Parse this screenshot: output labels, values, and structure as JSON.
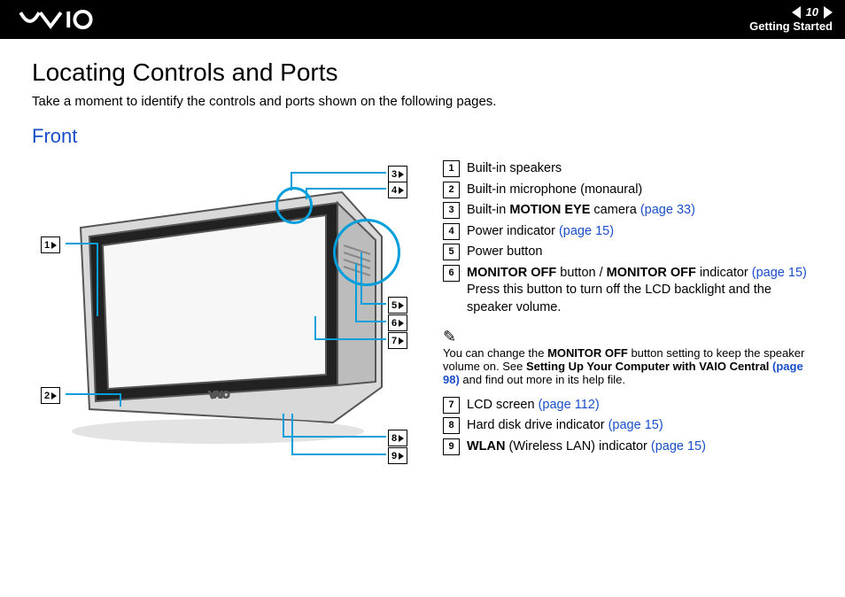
{
  "header": {
    "page_number": "10",
    "section": "Getting Started"
  },
  "title": "Locating Controls and Ports",
  "intro": "Take a moment to identify the controls and ports shown on the following pages.",
  "subhead": "Front",
  "items": [
    {
      "n": "1",
      "pre": "",
      "bold": "",
      "post": "Built-in speakers",
      "link": ""
    },
    {
      "n": "2",
      "pre": "",
      "bold": "",
      "post": "Built-in microphone (monaural)",
      "link": ""
    },
    {
      "n": "3",
      "pre": "Built-in ",
      "bold": "MOTION EYE",
      "post": " camera ",
      "link": "(page 33)"
    },
    {
      "n": "4",
      "pre": "",
      "bold": "",
      "post": "Power indicator ",
      "link": "(page 15)"
    },
    {
      "n": "5",
      "pre": "",
      "bold": "",
      "post": "Power button",
      "link": ""
    }
  ],
  "item6": {
    "n": "6",
    "part1": "MONITOR OFF",
    "mid": " button / ",
    "part2": "MONITOR OFF",
    "tail": " indicator ",
    "link": "(page 15)",
    "desc": "Press this button to turn off the LCD backlight and the speaker volume."
  },
  "note": {
    "pre": "You can change the ",
    "bold1": "MONITOR OFF",
    "mid": " button setting to keep the speaker volume on. See ",
    "bold2": "Setting Up Your Computer with VAIO Central ",
    "link": "(page 98)",
    "post": " and find out more in its help file."
  },
  "items2": [
    {
      "n": "7",
      "pre": "",
      "bold": "",
      "post": "LCD screen ",
      "link": "(page 112)"
    },
    {
      "n": "8",
      "pre": "",
      "bold": "",
      "post": "Hard disk drive indicator ",
      "link": "(page 15)"
    },
    {
      "n": "9",
      "pre": "",
      "bold": "WLAN",
      "post": " (Wireless LAN) indicator ",
      "link": "(page 15)"
    }
  ],
  "callouts": {
    "c1": "1",
    "c2": "2",
    "c3": "3",
    "c4": "4",
    "c5": "5",
    "c6": "6",
    "c7": "7",
    "c8": "8",
    "c9": "9"
  }
}
